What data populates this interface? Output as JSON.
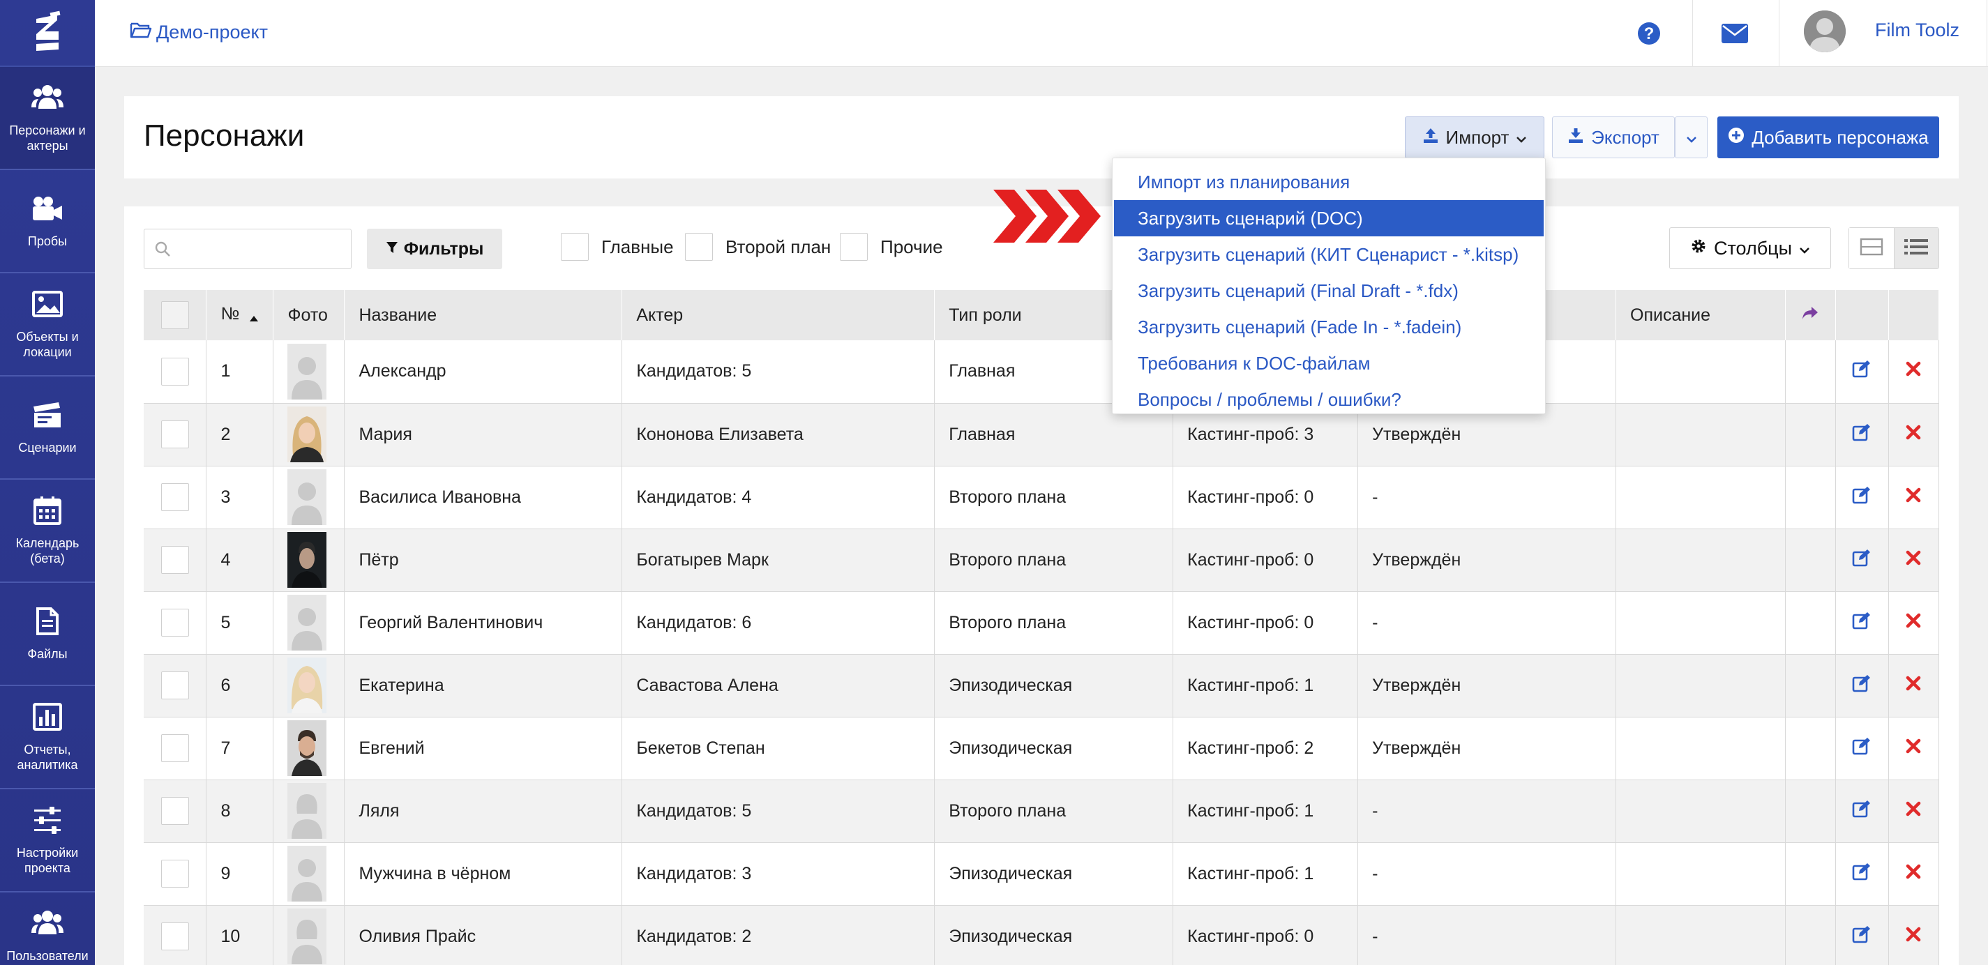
{
  "sidebar": {
    "items": [
      {
        "label": "Персонажи и актеры",
        "icon": "users-icon"
      },
      {
        "label": "Пробы",
        "icon": "video-camera-icon"
      },
      {
        "label": "Объекты и локации",
        "icon": "image-icon"
      },
      {
        "label": "Сценарии",
        "icon": "clapperboard-icon"
      },
      {
        "label": "Календарь (бета)",
        "icon": "calendar-icon"
      },
      {
        "label": "Файлы",
        "icon": "file-icon"
      },
      {
        "label": "Отчеты, аналитика",
        "icon": "bar-chart-icon"
      },
      {
        "label": "Настройки проекта",
        "icon": "sliders-icon"
      },
      {
        "label": "Пользователи и",
        "icon": "users-icon"
      }
    ]
  },
  "topbar": {
    "project": "Демо-проект",
    "user_name": "Film Toolz"
  },
  "header": {
    "title": "Персонажи",
    "import_label": "Импорт",
    "export_label": "Экспорт",
    "add_label": "Добавить персонажа"
  },
  "toolbar": {
    "search_placeholder": "",
    "filters_label": "Фильтры",
    "checkboxes": [
      "Главные",
      "Второй план",
      "Прочие"
    ],
    "columns_label": "Столбцы"
  },
  "import_menu": {
    "items": [
      "Импорт из планирования",
      "Загрузить сценарий (DOC)",
      "Загрузить сценарий (КИТ Сценарист - *.kitsp)",
      "Загрузить сценарий (Final Draft - *.fdx)",
      "Загрузить сценарий (Fade In - *.fadein)",
      "Требования к DOC-файлам",
      "Вопросы / проблемы / ошибки?"
    ],
    "highlighted_index": 1
  },
  "table": {
    "columns": [
      "№",
      "Фото",
      "Название",
      "Актер",
      "Тип роли",
      "",
      "",
      "Описание"
    ],
    "rows": [
      {
        "num": "1",
        "name": "Александр",
        "actor": "Кандидатов: 5",
        "role": "Главная",
        "casting": "",
        "status": "",
        "photo": "placeholder"
      },
      {
        "num": "2",
        "name": "Мария",
        "actor": "Кононова Елизавета",
        "role": "Главная",
        "casting": "Кастинг-проб: 3",
        "status": "Утверждён",
        "photo": "blonde"
      },
      {
        "num": "3",
        "name": "Василиса Ивановна",
        "actor": "Кандидатов: 4",
        "role": "Второго плана",
        "casting": "Кастинг-проб: 0",
        "status": "-",
        "photo": "placeholder"
      },
      {
        "num": "4",
        "name": "Пётр",
        "actor": "Богатырев Марк",
        "role": "Второго плана",
        "casting": "Кастинг-проб: 0",
        "status": "Утверждён",
        "photo": "dark"
      },
      {
        "num": "5",
        "name": "Георгий Валентинович",
        "actor": "Кандидатов: 6",
        "role": "Второго плана",
        "casting": "Кастинг-проб: 0",
        "status": "-",
        "photo": "placeholder"
      },
      {
        "num": "6",
        "name": "Екатерина",
        "actor": "Савастова Алена",
        "role": "Эпизодическая",
        "casting": "Кастинг-проб: 1",
        "status": "Утверждён",
        "photo": "blonde2"
      },
      {
        "num": "7",
        "name": "Евгений",
        "actor": "Бекетов Степан",
        "role": "Эпизодическая",
        "casting": "Кастинг-проб: 2",
        "status": "Утверждён",
        "photo": "man"
      },
      {
        "num": "8",
        "name": "Ляля",
        "actor": "Кандидатов: 5",
        "role": "Второго плана",
        "casting": "Кастинг-проб: 1",
        "status": "-",
        "photo": "placeholder-f"
      },
      {
        "num": "9",
        "name": "Мужчина в чёрном",
        "actor": "Кандидатов: 3",
        "role": "Эпизодическая",
        "casting": "Кастинг-проб: 1",
        "status": "-",
        "photo": "placeholder"
      },
      {
        "num": "10",
        "name": "Оливия Прайс",
        "actor": "Кандидатов: 2",
        "role": "Эпизодическая",
        "casting": "Кастинг-проб: 0",
        "status": "-",
        "photo": "placeholder-f"
      }
    ]
  },
  "colors": {
    "sidebar": "#2b3990",
    "accent": "#2b5cc6",
    "link": "#2a58c4",
    "delete": "#e02b2b",
    "arrow": "#e32020"
  }
}
